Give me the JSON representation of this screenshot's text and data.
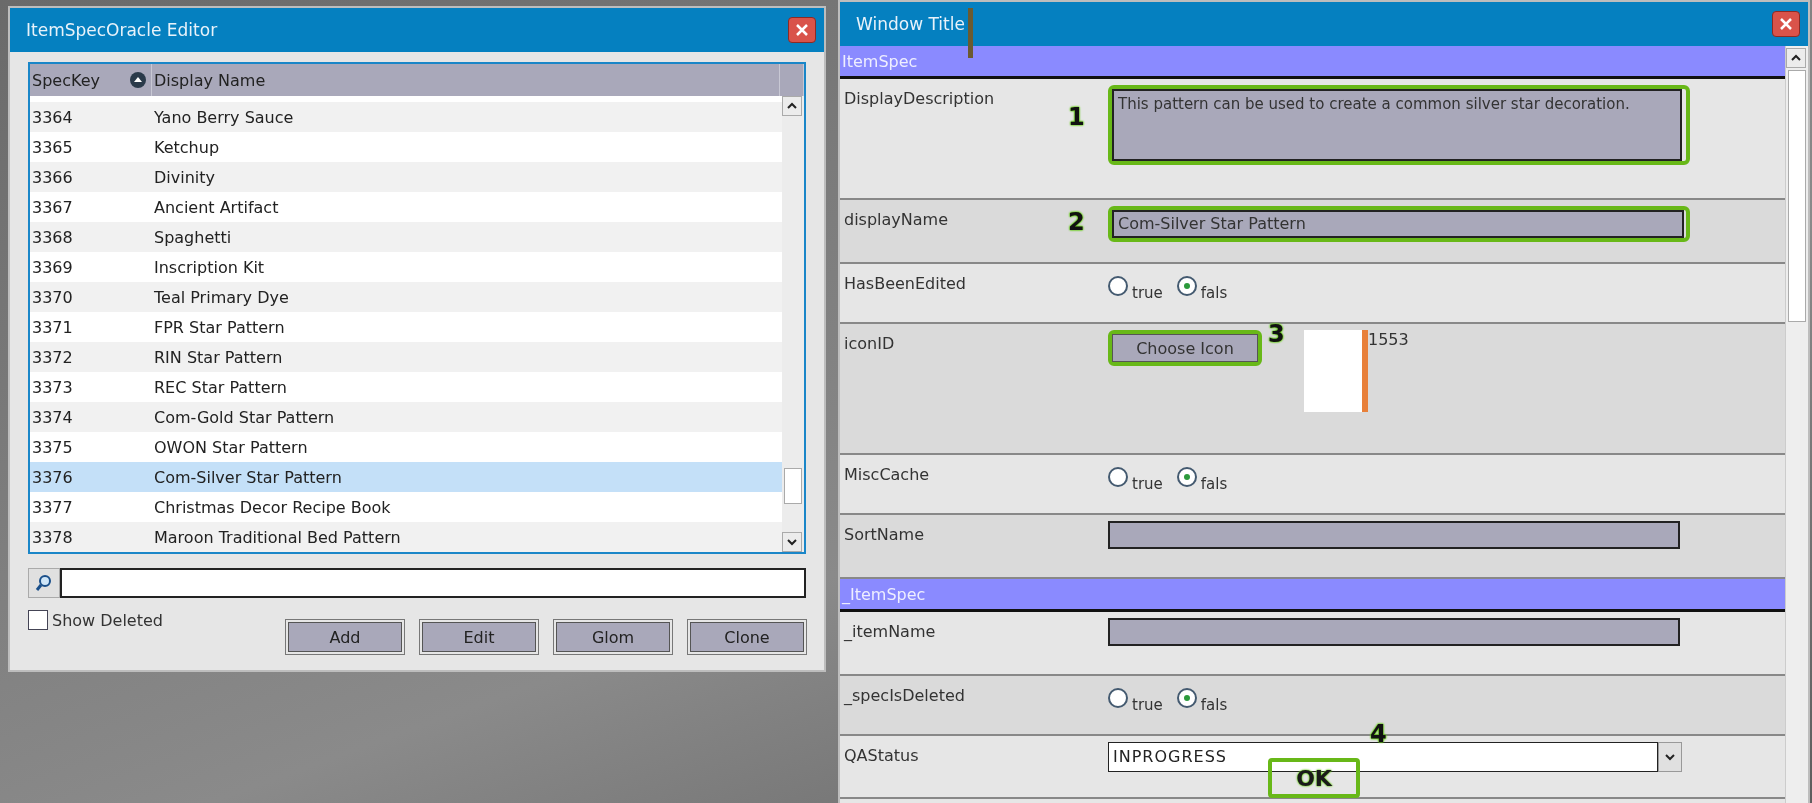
{
  "left_window": {
    "title": "ItemSpecOracle Editor",
    "table": {
      "columns": [
        "SpecKey",
        "Display Name"
      ],
      "rows": [
        {
          "spec_key": "3364",
          "display_name": "Yano Berry Sauce",
          "selected": false
        },
        {
          "spec_key": "3365",
          "display_name": "Ketchup",
          "selected": false
        },
        {
          "spec_key": "3366",
          "display_name": "Divinity",
          "selected": false
        },
        {
          "spec_key": "3367",
          "display_name": "Ancient Artifact",
          "selected": false
        },
        {
          "spec_key": "3368",
          "display_name": "Spaghetti",
          "selected": false
        },
        {
          "spec_key": "3369",
          "display_name": "Inscription Kit",
          "selected": false
        },
        {
          "spec_key": "3370",
          "display_name": "Teal Primary Dye",
          "selected": false
        },
        {
          "spec_key": "3371",
          "display_name": "FPR Star Pattern",
          "selected": false
        },
        {
          "spec_key": "3372",
          "display_name": "RIN Star Pattern",
          "selected": false
        },
        {
          "spec_key": "3373",
          "display_name": "REC Star Pattern",
          "selected": false
        },
        {
          "spec_key": "3374",
          "display_name": "Com-Gold Star Pattern",
          "selected": false
        },
        {
          "spec_key": "3375",
          "display_name": "OWON Star Pattern",
          "selected": false
        },
        {
          "spec_key": "3376",
          "display_name": "Com-Silver Star Pattern",
          "selected": true
        },
        {
          "spec_key": "3377",
          "display_name": "Christmas Decor Recipe Book",
          "selected": false
        },
        {
          "spec_key": "3378",
          "display_name": "Maroon Traditional Bed Pattern",
          "selected": false
        }
      ]
    },
    "show_deleted": {
      "label": "Show Deleted",
      "checked": false
    },
    "buttons": [
      "Add",
      "Edit",
      "Glom",
      "Clone"
    ]
  },
  "right_window": {
    "title": "Window Title",
    "sections": [
      {
        "title": "ItemSpec",
        "fields": [
          {
            "kind": "textarea",
            "label": "DisplayDescription",
            "value": "This pattern can be used to create a common silver star decoration.",
            "annotation": "1"
          },
          {
            "kind": "text",
            "label": "displayName",
            "value": "Com-Silver Star Pattern",
            "annotation": "2"
          },
          {
            "kind": "radio",
            "label": "HasBeenEdited",
            "options": [
              {
                "label": "true",
                "selected": false
              },
              {
                "label": "fals",
                "selected": true
              }
            ]
          },
          {
            "kind": "icon",
            "label": "iconID",
            "button": "Choose Icon",
            "value": "1553",
            "annotation": "3"
          },
          {
            "kind": "radio",
            "label": "MiscCache",
            "options": [
              {
                "label": "true",
                "selected": false
              },
              {
                "label": "fals",
                "selected": true
              }
            ]
          },
          {
            "kind": "text",
            "label": "SortName"
          }
        ]
      },
      {
        "title": "_ItemSpec",
        "fields": [
          {
            "kind": "text",
            "label": "_itemName"
          },
          {
            "kind": "radio",
            "label": "_specIsDeleted",
            "options": [
              {
                "label": "true",
                "selected": false
              },
              {
                "label": "fals",
                "selected": true
              }
            ]
          },
          {
            "kind": "select",
            "label": "QAStatus",
            "value": "INPROGRESS"
          }
        ]
      }
    ],
    "overlay": {
      "number": "4",
      "label": "OK"
    }
  }
}
